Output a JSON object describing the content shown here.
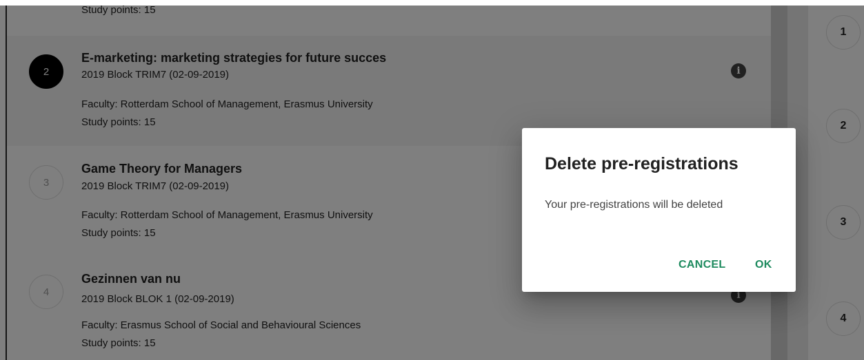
{
  "courses": [
    {
      "number": "",
      "title": "",
      "block": "",
      "faculty": "",
      "study_points": "Study points: 15"
    },
    {
      "number": "2",
      "title": "E-marketing: marketing strategies for future succes",
      "block": "2019 Block TRIM7 (02-09-2019)",
      "faculty": "Faculty: Rotterdam School of Management, Erasmus University",
      "study_points": "Study points: 15",
      "info_icon": "info-icon",
      "active": true
    },
    {
      "number": "3",
      "title": "Game Theory for Managers",
      "block": "2019 Block TRIM7 (02-09-2019)",
      "faculty": "Faculty: Rotterdam School of Management, Erasmus University",
      "study_points": "Study points: 15"
    },
    {
      "number": "4",
      "title": "Gezinnen van nu",
      "block": "2019 Block BLOK 1 (02-09-2019)",
      "faculty": "Faculty: Erasmus School of Social and Behavioural Sciences",
      "study_points": "Study points: 15",
      "info_icon": "info-icon"
    }
  ],
  "right_steps": [
    "1",
    "2",
    "3",
    "4"
  ],
  "dialog": {
    "title": "Delete pre-registrations",
    "message": "Your pre-registrations will be deleted",
    "cancel_label": "CANCEL",
    "ok_label": "OK"
  },
  "colors": {
    "accent": "#1d8a5e",
    "active_step": "#000000",
    "overlay": "rgba(0,0,0,0.5)"
  }
}
